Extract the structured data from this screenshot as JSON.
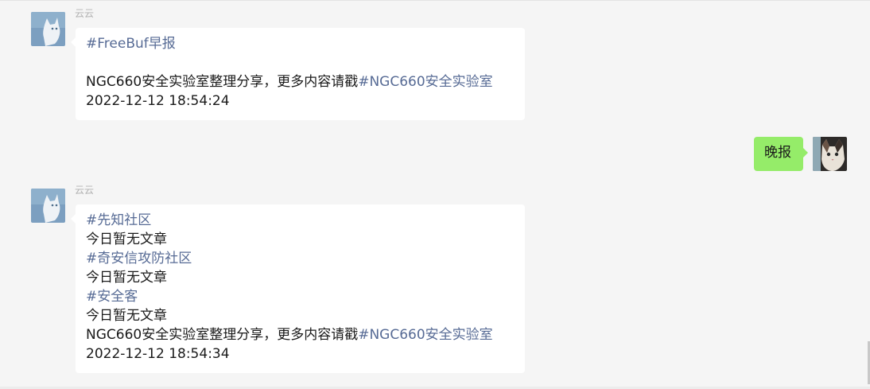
{
  "messages": [
    {
      "sender": "云云",
      "lines": [
        {
          "segments": [
            {
              "text": "#FreeBuf早报",
              "link": true
            }
          ]
        },
        {
          "segments": []
        },
        {
          "segments": [
            {
              "text": "NGC660安全实验室整理分享，更多内容请戳",
              "link": false
            },
            {
              "text": "#NGC660安全实验室",
              "link": true
            }
          ]
        },
        {
          "segments": [
            {
              "text": "2022-12-12 18:54:24",
              "link": false
            }
          ]
        }
      ]
    },
    {
      "self_text": "晚报"
    },
    {
      "sender": "云云",
      "lines": [
        {
          "segments": [
            {
              "text": "#先知社区",
              "link": true
            }
          ]
        },
        {
          "segments": [
            {
              "text": "今日暂无文章",
              "link": false
            }
          ]
        },
        {
          "segments": [
            {
              "text": "#奇安信攻防社区",
              "link": true
            }
          ]
        },
        {
          "segments": [
            {
              "text": "今日暂无文章",
              "link": false
            }
          ]
        },
        {
          "segments": [
            {
              "text": "#安全客",
              "link": true
            }
          ]
        },
        {
          "segments": [
            {
              "text": "今日暂无文章",
              "link": false
            }
          ]
        },
        {
          "segments": [
            {
              "text": "NGC660安全实验室整理分享，更多内容请戳",
              "link": false
            },
            {
              "text": "#NGC660安全实验室",
              "link": true
            }
          ]
        },
        {
          "segments": [
            {
              "text": "2022-12-12 18:54:34",
              "link": false
            }
          ]
        }
      ]
    }
  ],
  "colors": {
    "background": "#f5f5f5",
    "bubble_in": "#ffffff",
    "bubble_out": "#95ec69",
    "link": "#576b95",
    "sender_name": "#b2b2b2"
  },
  "icons": {
    "contact_avatar": "white-cat-avatar",
    "self_avatar": "kitten-avatar"
  }
}
